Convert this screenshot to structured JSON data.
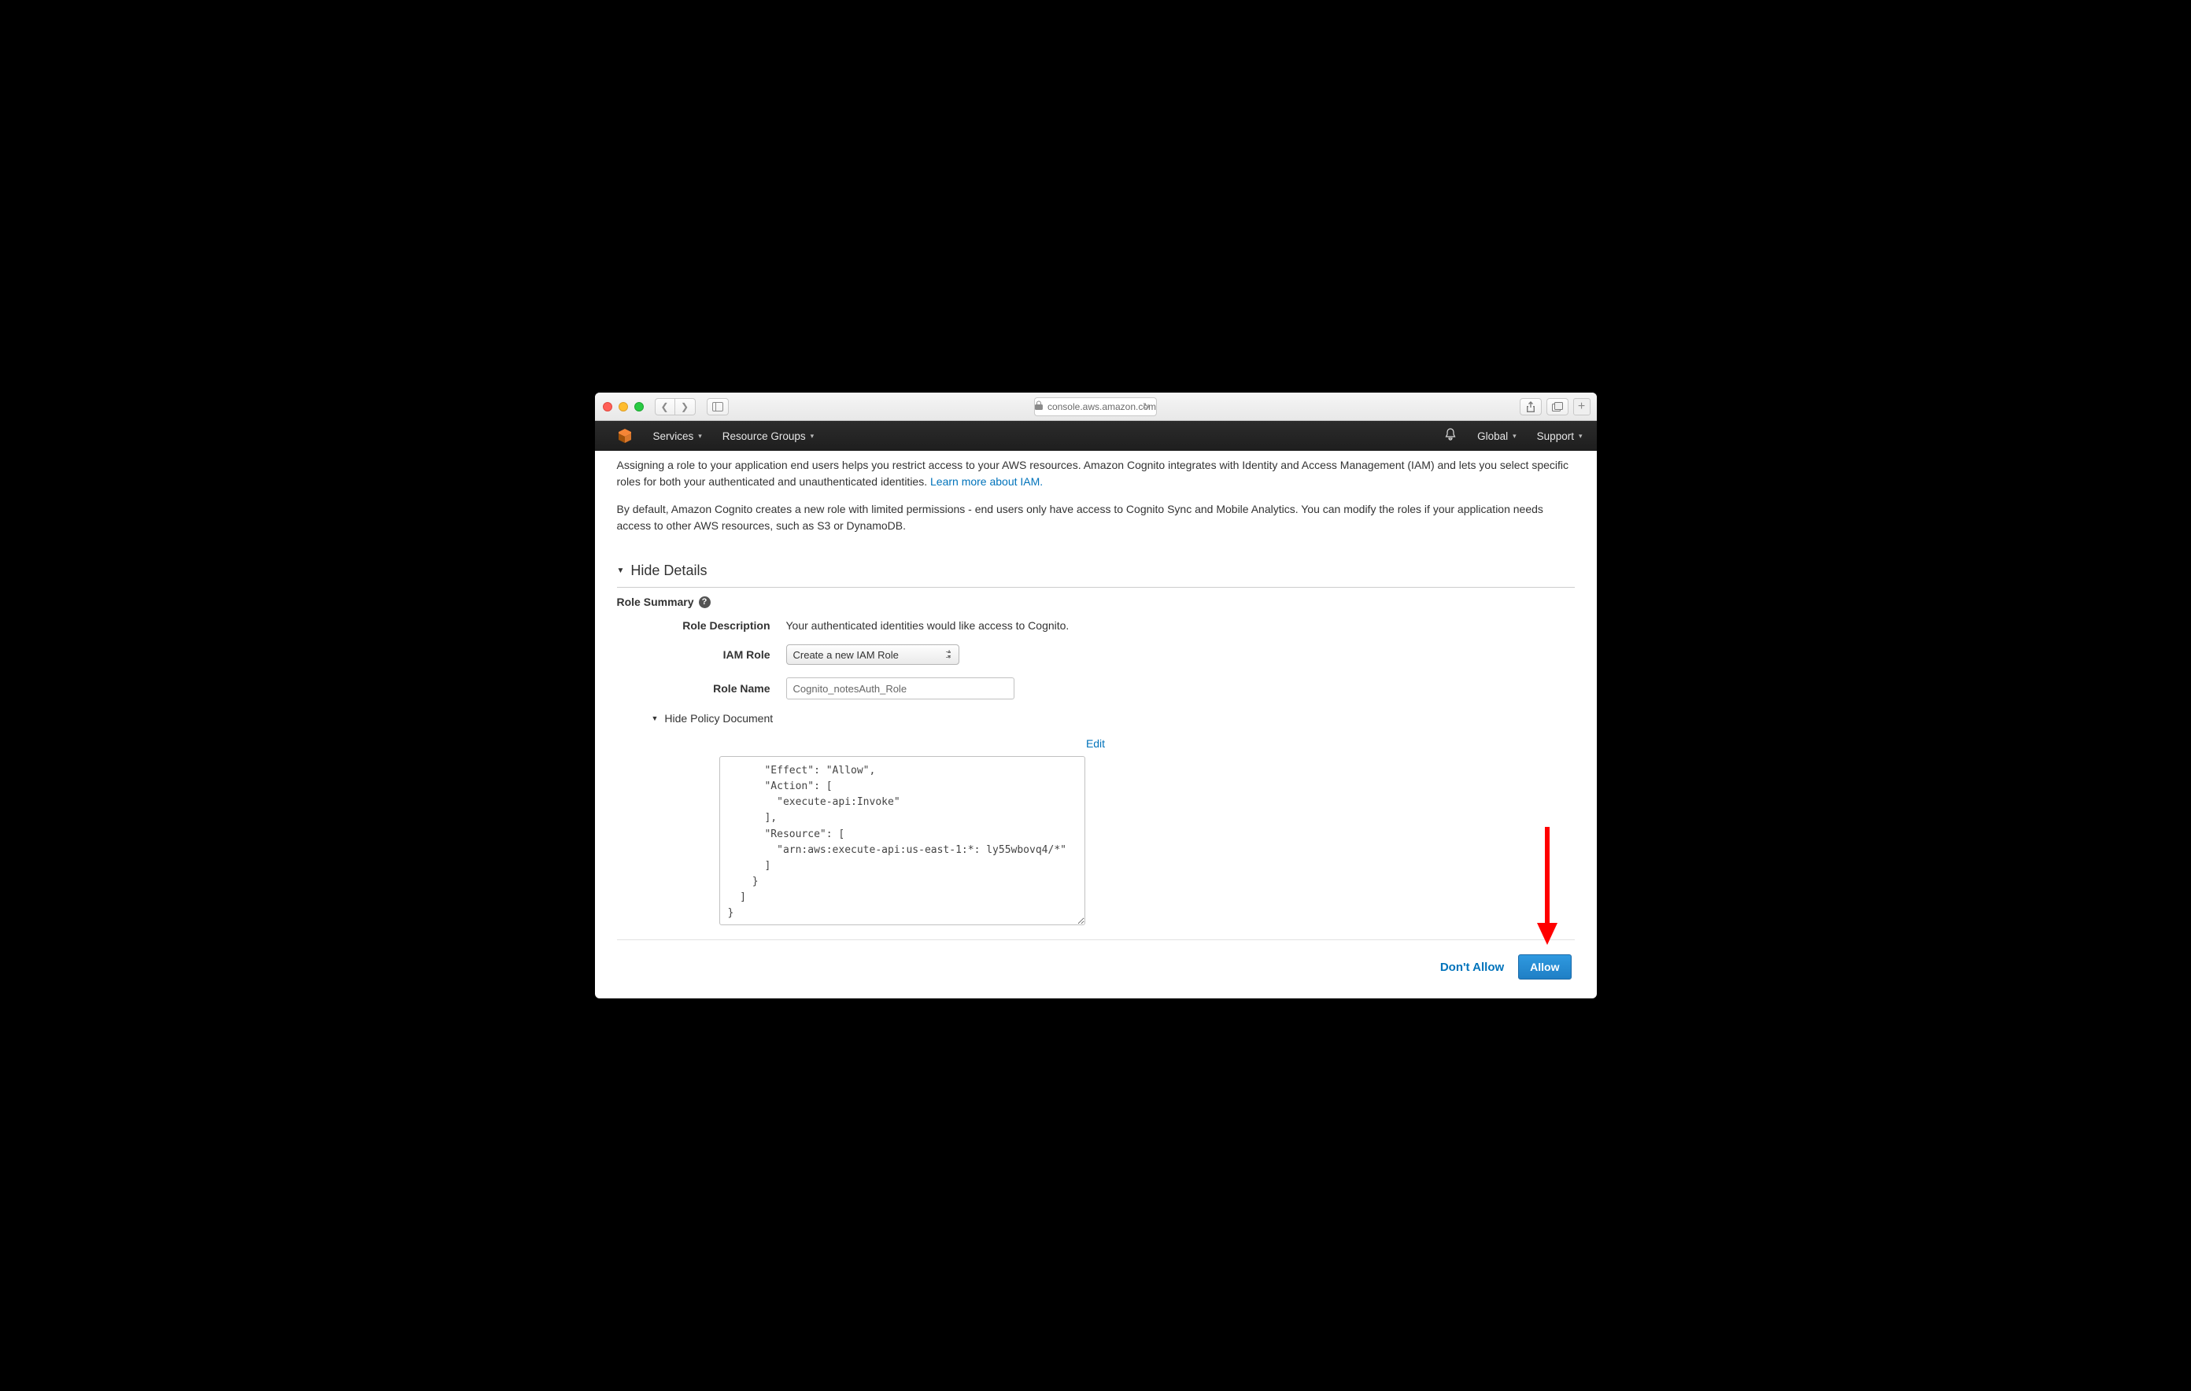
{
  "browser": {
    "url": "console.aws.amazon.com"
  },
  "awsNav": {
    "services": "Services",
    "resourceGroups": "Resource Groups",
    "region": "Global",
    "support": "Support"
  },
  "intro": {
    "p1": "Assigning a role to your application end users helps you restrict access to your AWS resources. Amazon Cognito integrates with Identity and Access Management (IAM) and lets you select specific roles for both your authenticated and unauthenticated identities.  ",
    "p1link": "Learn more about IAM.",
    "p2": "By default, Amazon Cognito creates a new role with limited permissions - end users only have access to Cognito Sync and Mobile Analytics. You can modify the roles if your application needs access to other AWS resources, such as S3 or DynamoDB."
  },
  "hideDetails": "Hide Details",
  "roleSummary": "Role Summary",
  "form": {
    "roleDescLabel": "Role Description",
    "roleDescValue": "Your authenticated identities would like access to Cognito.",
    "iamRoleLabel": "IAM Role",
    "iamRoleValue": "Create a new IAM Role",
    "roleNameLabel": "Role Name",
    "roleNameValue": "Cognito_notesAuth_Role"
  },
  "hidePolicy": "Hide Policy Document",
  "editLabel": "Edit",
  "policy": "      \"Effect\": \"Allow\",\n      \"Action\": [\n        \"execute-api:Invoke\"\n      ],\n      \"Resource\": [\n        \"arn:aws:execute-api:us-east-1:*: ly55wbovq4/*\"\n      ]\n    }\n  ]\n}",
  "footer": {
    "dont": "Don't Allow",
    "allow": "Allow"
  }
}
